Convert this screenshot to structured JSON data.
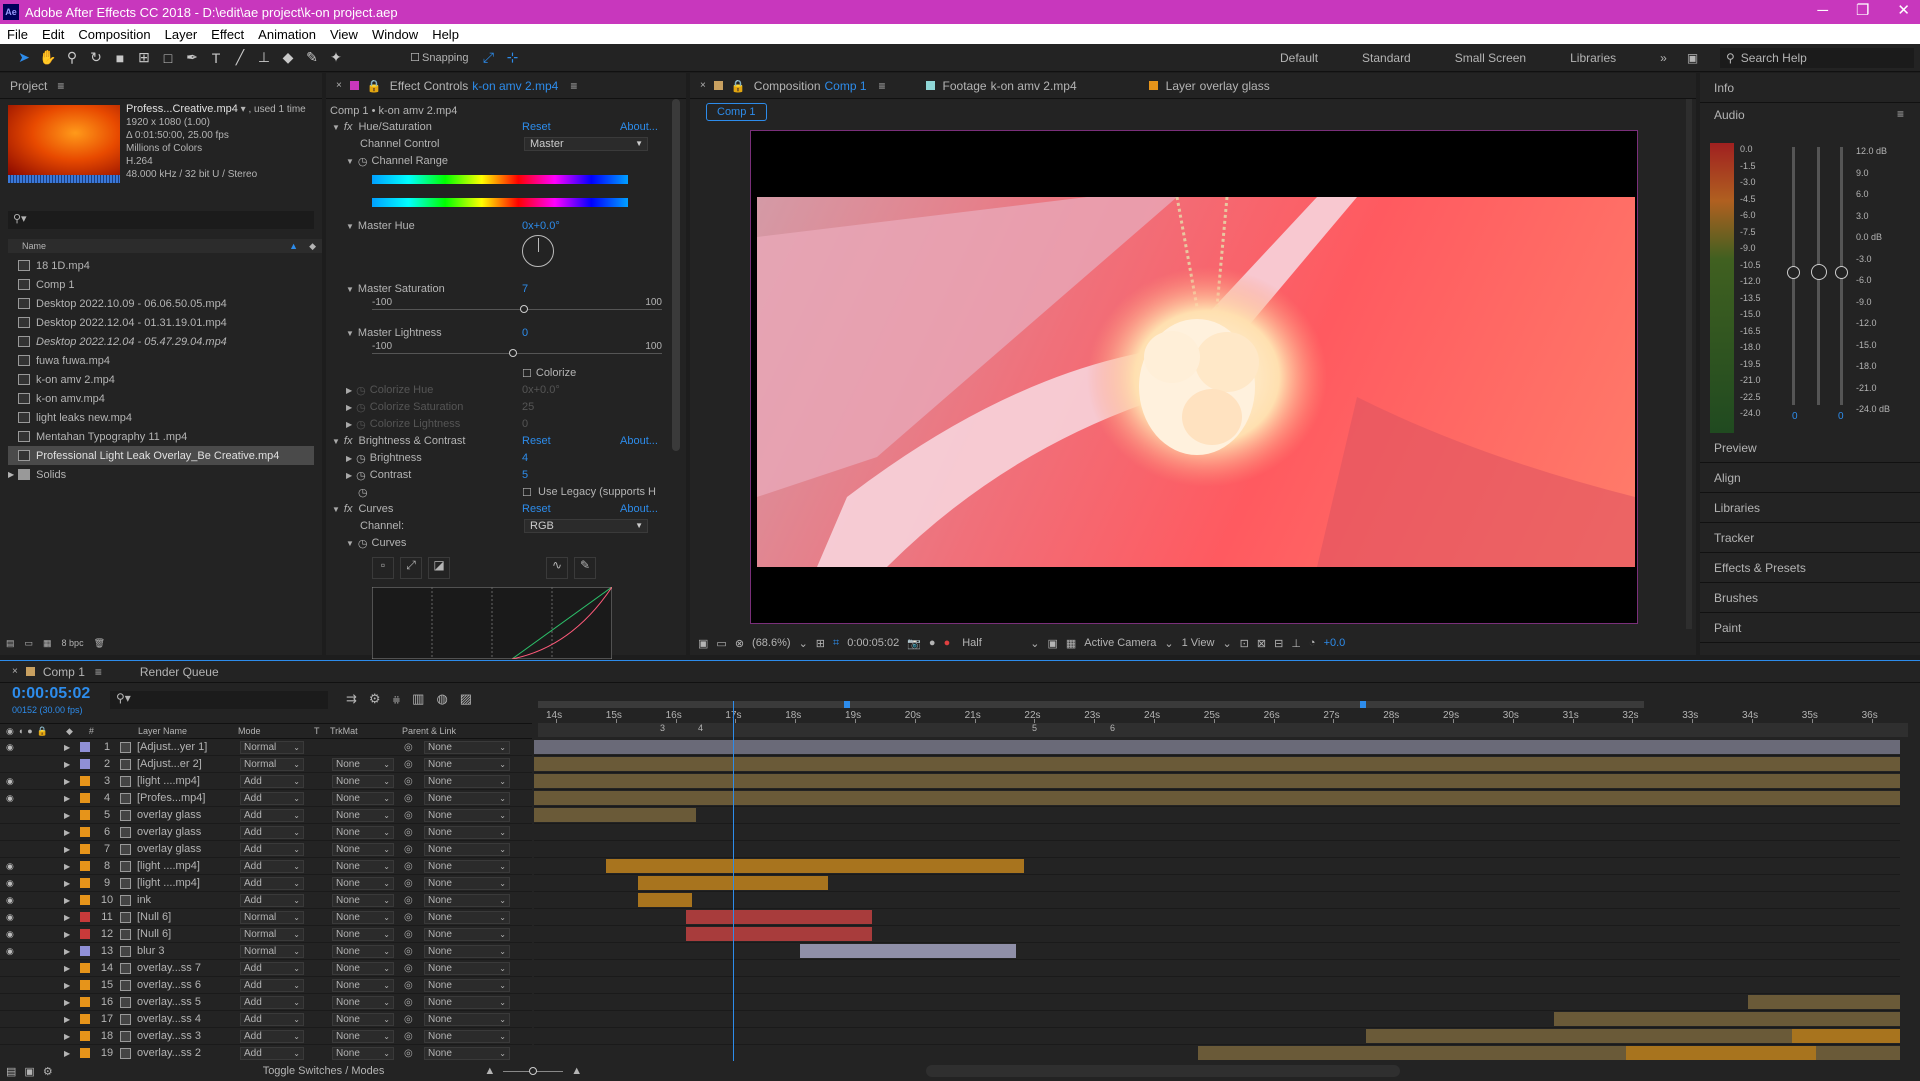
{
  "window": {
    "title": "Adobe After Effects CC 2018 - D:\\edit\\ae project\\k-on project.aep",
    "logo": "Ae",
    "minimize": "─",
    "maximize": "❐",
    "close": "✕"
  },
  "menu": [
    "File",
    "Edit",
    "Composition",
    "Layer",
    "Effect",
    "Animation",
    "View",
    "Window",
    "Help"
  ],
  "toolbar": {
    "snapping": "Snapping",
    "workspaces": [
      "Default",
      "Standard",
      "Small Screen",
      "Libraries"
    ],
    "search_placeholder": "Search Help"
  },
  "project": {
    "tab": "Project",
    "selected_name": "Profess...Creative.mp4",
    "used": ", used 1 time",
    "info": [
      "1920 x 1080 (1.00)",
      "Δ 0:01:50:00, 25.00 fps",
      "Millions of Colors",
      "H.264",
      "48.000 kHz / 32 bit U / Stereo"
    ],
    "col_name": "Name",
    "items": [
      "18 1D.mp4",
      "Comp 1",
      "Desktop 2022.10.09 - 06.06.50.05.mp4",
      "Desktop 2022.12.04 - 01.31.19.01.mp4",
      "Desktop 2022.12.04 - 05.47.29.04.mp4",
      "fuwa fuwa.mp4",
      "k-on amv 2.mp4",
      "k-on amv.mp4",
      "light leaks new.mp4",
      "Mentahan Typography 11 .mp4",
      "Professional Light Leak Overlay_Be Creative.mp4",
      "Solids"
    ],
    "bpc": "8 bpc"
  },
  "effects": {
    "tab_label": "Effect Controls",
    "tab_file": "k-on amv 2.mp4",
    "sub": "Comp 1 • k-on amv 2.mp4",
    "hue": "Hue/Saturation",
    "reset": "Reset",
    "about": "About...",
    "channel_control": "Channel Control",
    "channel_value": "Master",
    "channel_range": "Channel Range",
    "master_hue": "Master Hue",
    "master_hue_val": "0x+0.0°",
    "master_sat": "Master Saturation",
    "master_sat_val": "7",
    "sat_min": "-100",
    "sat_max": "100",
    "master_light": "Master Lightness",
    "master_light_val": "0",
    "light_min": "-100",
    "light_max": "100",
    "colorize": "Colorize",
    "colorize_hue": "Colorize Hue",
    "colorize_hue_val": "0x+0.0°",
    "colorize_sat": "Colorize Saturation",
    "colorize_sat_val": "25",
    "colorize_light": "Colorize Lightness",
    "colorize_light_val": "0",
    "bc": "Brightness & Contrast",
    "brightness": "Brightness",
    "brightness_val": "4",
    "contrast": "Contrast",
    "contrast_val": "5",
    "legacy": "Use Legacy (supports H",
    "curves": "Curves",
    "channel": "Channel:",
    "channel_rgb": "RGB",
    "curves_sub": "Curves"
  },
  "composition": {
    "tab_label": "Composition",
    "tab_comp": "Comp 1",
    "footage_label": "Footage",
    "footage_file": "k-on amv 2.mp4",
    "layer_label": "Layer",
    "layer_name": "overlay glass",
    "crumb": "Comp 1",
    "zoom": "(68.6%)",
    "time": "0:00:05:02",
    "res": "Half",
    "camera": "Active Camera",
    "views": "1 View",
    "exposure": "+0.0"
  },
  "right": {
    "info": "Info",
    "audio": "Audio",
    "db_left": [
      "0.0",
      "-1.5",
      "-3.0",
      "-4.5",
      "-6.0",
      "-7.5",
      "-9.0",
      "-10.5",
      "-12.0",
      "-13.5",
      "-15.0",
      "-16.5",
      "-18.0",
      "-19.5",
      "-21.0",
      "-22.5",
      "-24.0"
    ],
    "db_right": [
      "12.0 dB",
      "9.0",
      "6.0",
      "3.0",
      "0.0 dB",
      "-3.0",
      "-6.0",
      "-9.0",
      "-12.0",
      "-15.0",
      "-18.0",
      "-21.0",
      "-24.0 dB"
    ],
    "audio_vals": [
      "0",
      "0"
    ],
    "panels": [
      "Preview",
      "Align",
      "Libraries",
      "Tracker",
      "Effects & Presets",
      "Brushes",
      "Paint"
    ]
  },
  "timeline": {
    "tab": "Comp 1",
    "render_queue": "Render Queue",
    "timecode": "0:00:05:02",
    "fps": "00152 (30.00 fps)",
    "cols": {
      "layer_name": "Layer Name",
      "mode": "Mode",
      "t": "T",
      "trkmat": "TrkMat",
      "parent": "Parent & Link"
    },
    "ruler": [
      "14s",
      "15s",
      "16s",
      "17s",
      "18s",
      "19s",
      "20s",
      "21s",
      "22s",
      "23s",
      "24s",
      "25s",
      "26s",
      "27s",
      "28s",
      "29s",
      "30s",
      "31s",
      "32s",
      "33s",
      "34s",
      "35s",
      "36s"
    ],
    "markers": [
      "3",
      "4",
      "5",
      "6"
    ],
    "layers": [
      {
        "n": "1",
        "name": "[Adjust...yer 1]",
        "mode": "Normal",
        "trk": "",
        "parent": "None",
        "color": "#8f8fd6",
        "eye": true
      },
      {
        "n": "2",
        "name": "[Adjust...er 2]",
        "mode": "Normal",
        "trk": "None",
        "parent": "None",
        "color": "#8f8fd6",
        "eye": false
      },
      {
        "n": "3",
        "name": "[light ....mp4]",
        "mode": "Add",
        "trk": "None",
        "parent": "None",
        "color": "#e6941a",
        "eye": true
      },
      {
        "n": "4",
        "name": "[Profes...mp4]",
        "mode": "Add",
        "trk": "None",
        "parent": "None",
        "color": "#e6941a",
        "eye": true
      },
      {
        "n": "5",
        "name": "overlay glass",
        "mode": "Add",
        "trk": "None",
        "parent": "None",
        "color": "#e6941a",
        "eye": false
      },
      {
        "n": "6",
        "name": "overlay glass",
        "mode": "Add",
        "trk": "None",
        "parent": "None",
        "color": "#e6941a",
        "eye": false
      },
      {
        "n": "7",
        "name": "overlay glass",
        "mode": "Add",
        "trk": "None",
        "parent": "None",
        "color": "#e6941a",
        "eye": false
      },
      {
        "n": "8",
        "name": "[light ....mp4]",
        "mode": "Add",
        "trk": "None",
        "parent": "None",
        "color": "#e6941a",
        "eye": true
      },
      {
        "n": "9",
        "name": "[light ....mp4]",
        "mode": "Add",
        "trk": "None",
        "parent": "None",
        "color": "#e6941a",
        "eye": true
      },
      {
        "n": "10",
        "name": "ink",
        "mode": "Add",
        "trk": "None",
        "parent": "None",
        "color": "#e6941a",
        "eye": true
      },
      {
        "n": "11",
        "name": "[Null 6]",
        "mode": "Normal",
        "trk": "None",
        "parent": "None",
        "color": "#c83a3a",
        "eye": true
      },
      {
        "n": "12",
        "name": "[Null 6]",
        "mode": "Normal",
        "trk": "None",
        "parent": "None",
        "color": "#c83a3a",
        "eye": true
      },
      {
        "n": "13",
        "name": "blur 3",
        "mode": "Normal",
        "trk": "None",
        "parent": "None",
        "color": "#8f8fd6",
        "eye": true
      },
      {
        "n": "14",
        "name": "overlay...ss 7",
        "mode": "Add",
        "trk": "None",
        "parent": "None",
        "color": "#e6941a",
        "eye": false
      },
      {
        "n": "15",
        "name": "overlay...ss 6",
        "mode": "Add",
        "trk": "None",
        "parent": "None",
        "color": "#e6941a",
        "eye": false
      },
      {
        "n": "16",
        "name": "overlay...ss 5",
        "mode": "Add",
        "trk": "None",
        "parent": "None",
        "color": "#e6941a",
        "eye": false
      },
      {
        "n": "17",
        "name": "overlay...ss 4",
        "mode": "Add",
        "trk": "None",
        "parent": "None",
        "color": "#e6941a",
        "eye": false
      },
      {
        "n": "18",
        "name": "overlay...ss 3",
        "mode": "Add",
        "trk": "None",
        "parent": "None",
        "color": "#e6941a",
        "eye": false
      },
      {
        "n": "19",
        "name": "overlay...ss 2",
        "mode": "Add",
        "trk": "None",
        "parent": "None",
        "color": "#e6941a",
        "eye": false
      }
    ],
    "toggle": "Toggle Switches / Modes"
  }
}
